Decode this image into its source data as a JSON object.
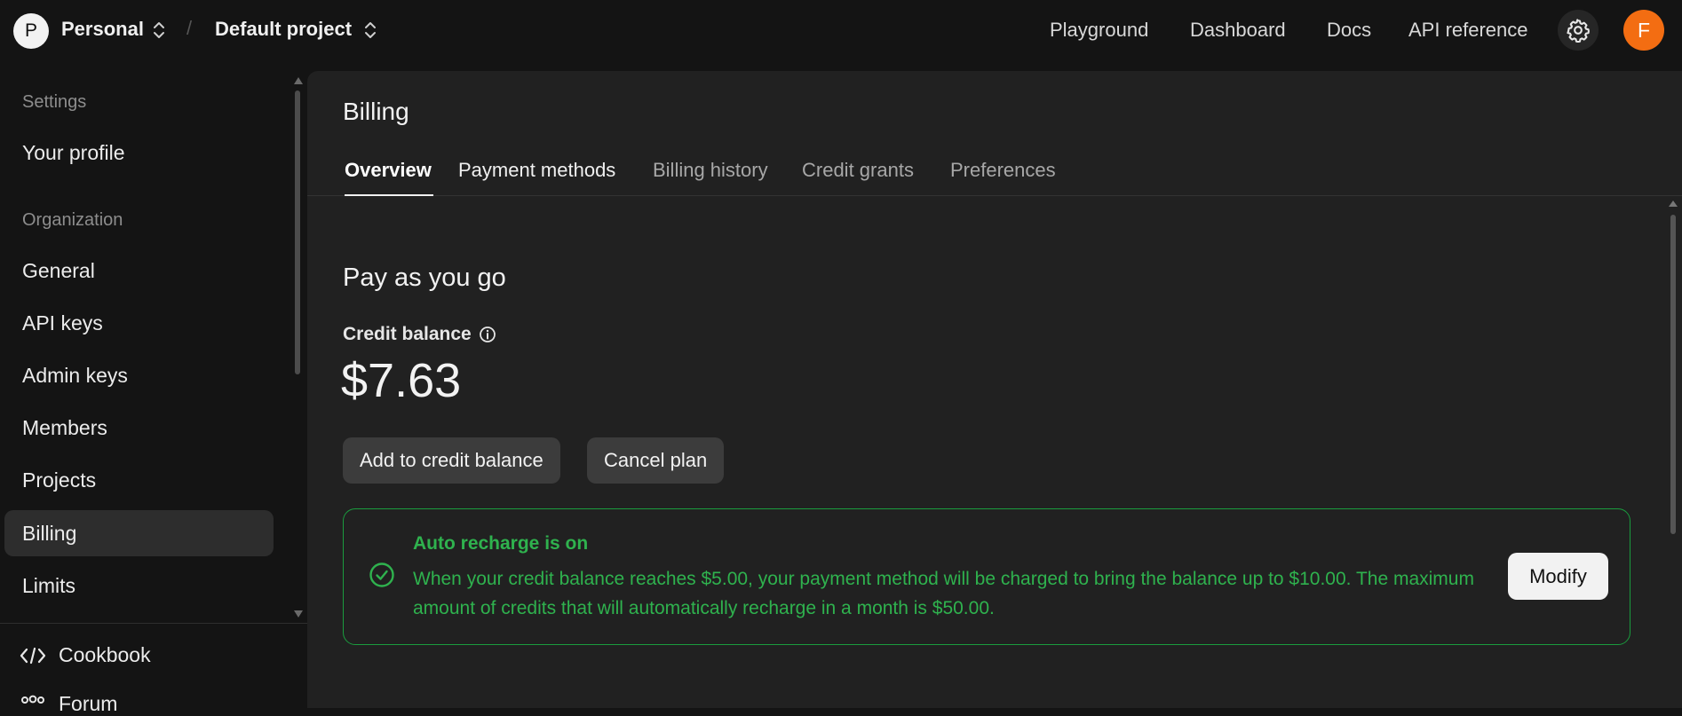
{
  "topbar": {
    "org_initial": "P",
    "org_name": "Personal",
    "separator": "/",
    "project_name": "Default project",
    "nav": [
      "Playground",
      "Dashboard",
      "Docs",
      "API reference"
    ],
    "user_initial": "F",
    "user_avatar_color": "#f36d12"
  },
  "sidebar": {
    "settings_heading": "Settings",
    "profile_item": "Your profile",
    "org_heading": "Organization",
    "org_items": [
      "General",
      "API keys",
      "Admin keys",
      "Members",
      "Projects",
      "Billing",
      "Limits"
    ],
    "active_item": "Billing",
    "footer": {
      "cookbook": "Cookbook",
      "forum": "Forum"
    }
  },
  "main": {
    "title": "Billing",
    "tabs": [
      "Overview",
      "Payment methods",
      "Billing history",
      "Credit grants",
      "Preferences"
    ],
    "active_tab": "Overview",
    "section_title": "Pay as you go",
    "balance_label": "Credit balance",
    "balance_amount": "$7.63",
    "add_credit_button": "Add to credit balance",
    "cancel_plan_button": "Cancel plan",
    "recharge": {
      "title": "Auto recharge is on",
      "text": "When your credit balance reaches $5.00, your payment method will be charged to bring the balance up to $10.00. The maximum amount of credits that will automatically recharge in a month is $50.00.",
      "modify_button": "Modify",
      "color": "#2fb24e"
    }
  }
}
